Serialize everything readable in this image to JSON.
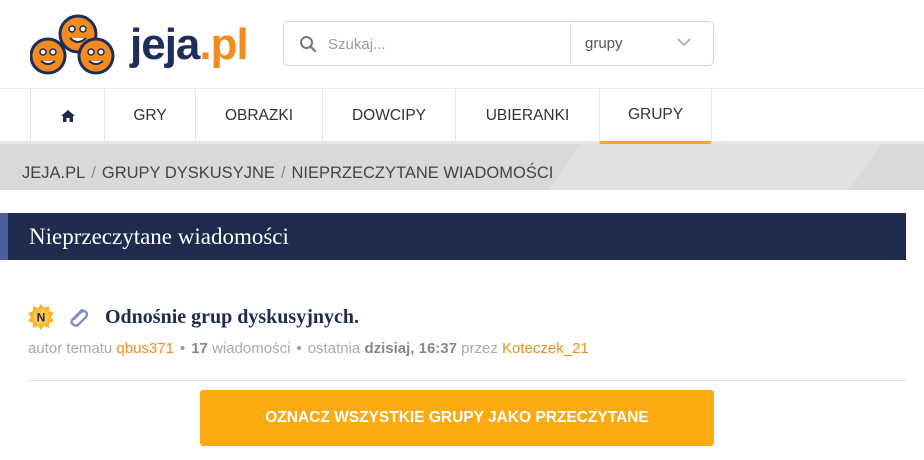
{
  "brand": {
    "logo_text_dark": "jeja",
    "logo_text_orange": ".pl"
  },
  "search": {
    "placeholder": "Szukaj...",
    "scope_value": "grupy"
  },
  "nav": {
    "home_icon": "home-icon",
    "items": [
      {
        "label": "GRY"
      },
      {
        "label": "OBRAZKI"
      },
      {
        "label": "DOWCIPY"
      },
      {
        "label": "UBIERANKI"
      },
      {
        "label": "GRUPY",
        "active": true
      }
    ]
  },
  "breadcrumb": {
    "items": [
      "JEJA.PL",
      "GRUPY DYSKUSYJNE",
      "NIEPRZECZYTANE WIADOMOŚCI"
    ],
    "separator": "/"
  },
  "page": {
    "title": "Nieprzeczytane wiadomości"
  },
  "topic": {
    "badge_letter": "N",
    "title": "Odnośnie grup dyskusyjnych.",
    "author_label": "autor tematu",
    "author": "qbus371",
    "message_count": "17",
    "messages_label": "wiadomości",
    "last_label": "ostatnia",
    "last_time": "dzisiaj, 16:37",
    "by_label": "przez",
    "last_author": "Koteczek_21"
  },
  "actions": {
    "mark_all_read": "OZNACZ WSZYSTKIE GRUPY JAKO PRZECZYTANE"
  },
  "colors": {
    "navy": "#1f2a4f",
    "orange": "#f28c1e",
    "button": "#fbab10",
    "nav_active": "#f7a81b"
  }
}
